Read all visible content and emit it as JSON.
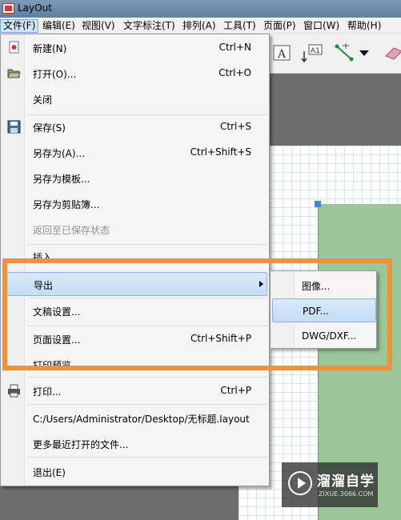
{
  "window": {
    "title": "LayOut"
  },
  "menubar": {
    "items": [
      {
        "label": "文件(F)",
        "active": true
      },
      {
        "label": "编辑(E)"
      },
      {
        "label": "视图(V)"
      },
      {
        "label": "文字标注(T)"
      },
      {
        "label": "排列(A)"
      },
      {
        "label": "工具(T)"
      },
      {
        "label": "页面(P)"
      },
      {
        "label": "窗口(W)"
      },
      {
        "label": "帮助(H)"
      }
    ]
  },
  "file_menu": {
    "items": [
      {
        "label": "新建(N)",
        "shortcut": "Ctrl+N",
        "icon": "new-file-icon"
      },
      {
        "label": "打开(O)...",
        "shortcut": "Ctrl+O",
        "icon": "open-folder-icon"
      },
      {
        "label": "关闭",
        "shortcut": ""
      },
      {
        "label": "保存(S)",
        "shortcut": "Ctrl+S",
        "icon": "save-disk-icon"
      },
      {
        "label": "另存为(A)...",
        "shortcut": "Ctrl+Shift+S"
      },
      {
        "label": "另存为模板...",
        "shortcut": ""
      },
      {
        "label": "另存为剪贴簿...",
        "shortcut": ""
      },
      {
        "label": "返回至已保存状态",
        "shortcut": "",
        "disabled": true
      },
      {
        "label": "插入...",
        "shortcut": ""
      },
      {
        "label": "导出",
        "shortcut": "",
        "submenu": true,
        "highlighted": true
      },
      {
        "label": "文稿设置...",
        "shortcut": ""
      },
      {
        "label": "页面设置...",
        "shortcut": "Ctrl+Shift+P"
      },
      {
        "label": "打印预览...",
        "shortcut": ""
      },
      {
        "label": "打印...",
        "shortcut": "Ctrl+P",
        "icon": "printer-icon"
      },
      {
        "label": "C:/Users/Administrator/Desktop/无标题.layout",
        "shortcut": ""
      },
      {
        "label": "更多最近打开的文件...",
        "shortcut": ""
      },
      {
        "label": "退出(E)",
        "shortcut": ""
      }
    ]
  },
  "export_submenu": {
    "items": [
      {
        "label": "图像..."
      },
      {
        "label": "PDF...",
        "highlighted": true
      },
      {
        "label": "DWG/DXF..."
      }
    ]
  },
  "watermark": {
    "brand": "溜溜自学",
    "site": "ZIXUE.3066.COM"
  },
  "colors": {
    "highlight_frame": "#f0923a",
    "menu_highlight": "#c3dcf6",
    "green_shape": "#9cc59a"
  }
}
